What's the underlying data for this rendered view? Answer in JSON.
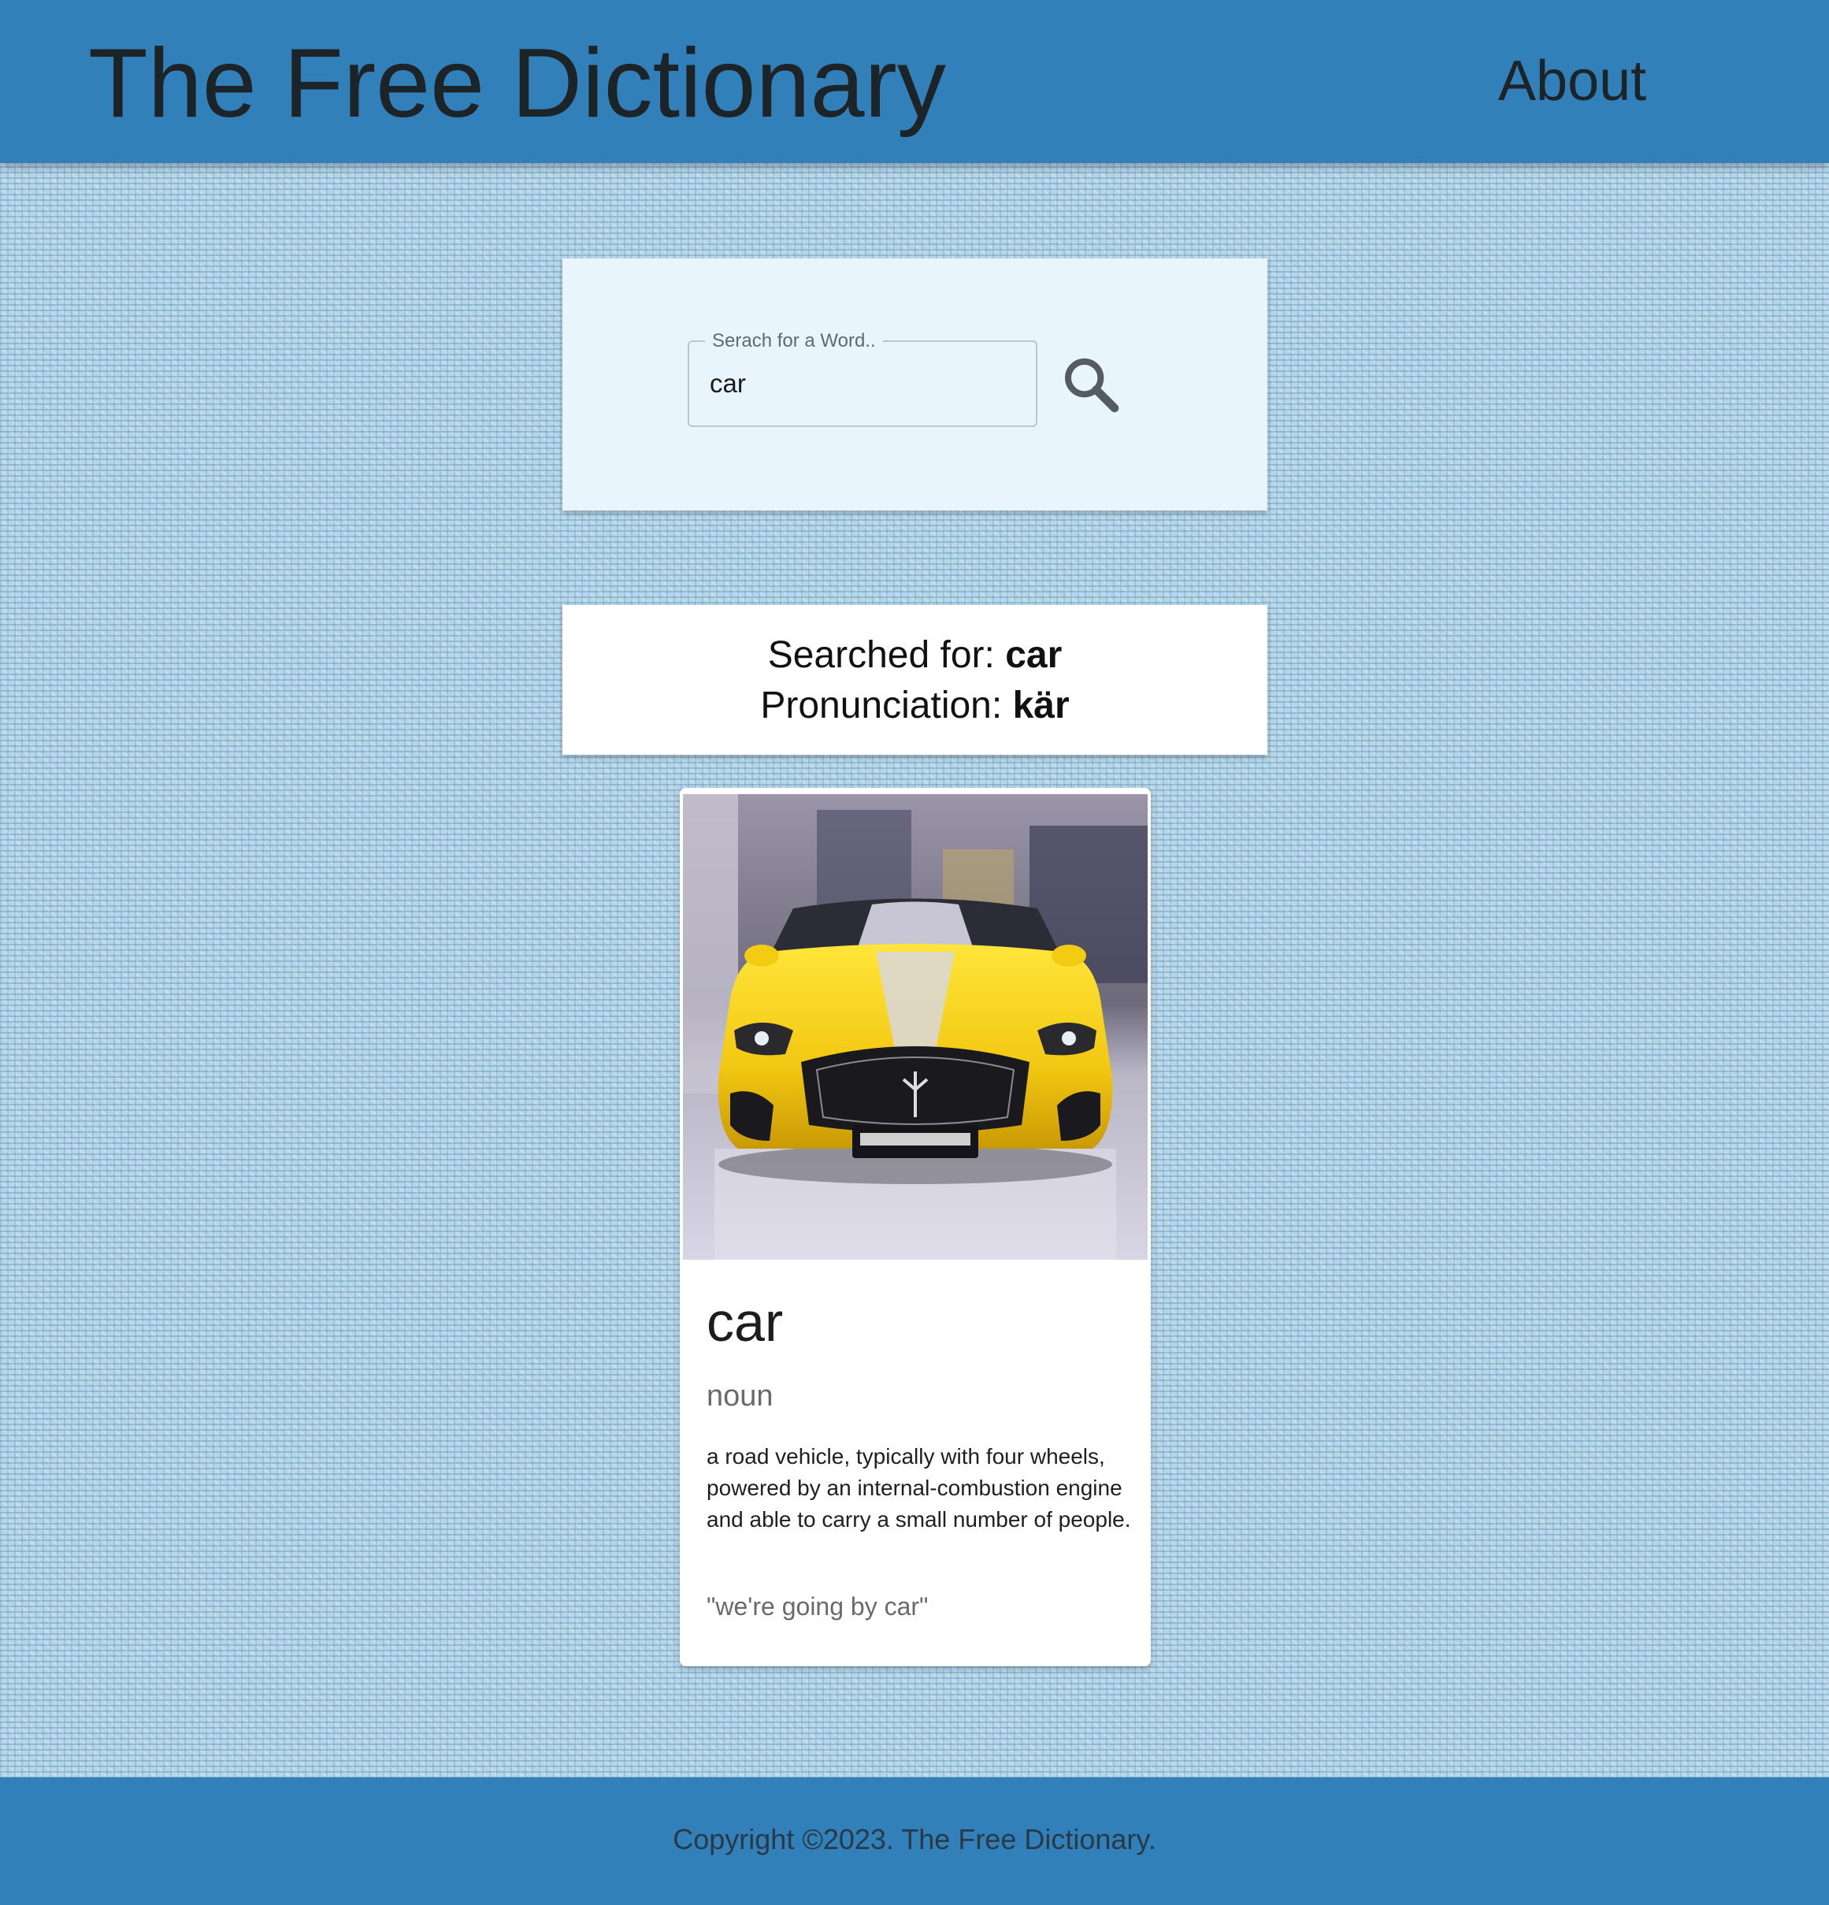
{
  "header": {
    "title": "The Free Dictionary",
    "nav_about": "About",
    "background_color": "#3180b9"
  },
  "search": {
    "label": "Serach for a Word..",
    "value": "car",
    "button_icon": "search-icon"
  },
  "summary": {
    "searched_label": "Searched for:",
    "searched_word": "car",
    "pronunciation_label": "Pronunciation:",
    "pronunciation": "kär"
  },
  "card": {
    "image_subject": "yellow sports car front view",
    "word": "car",
    "part_of_speech": "noun",
    "definition": "a road vehicle, typically with four wheels, powered by an internal-combustion engine and able to carry a small number of people.",
    "example": "\"we're going by car\""
  },
  "footer": {
    "copyright": "Copyright ©2023. The Free Dictionary."
  }
}
